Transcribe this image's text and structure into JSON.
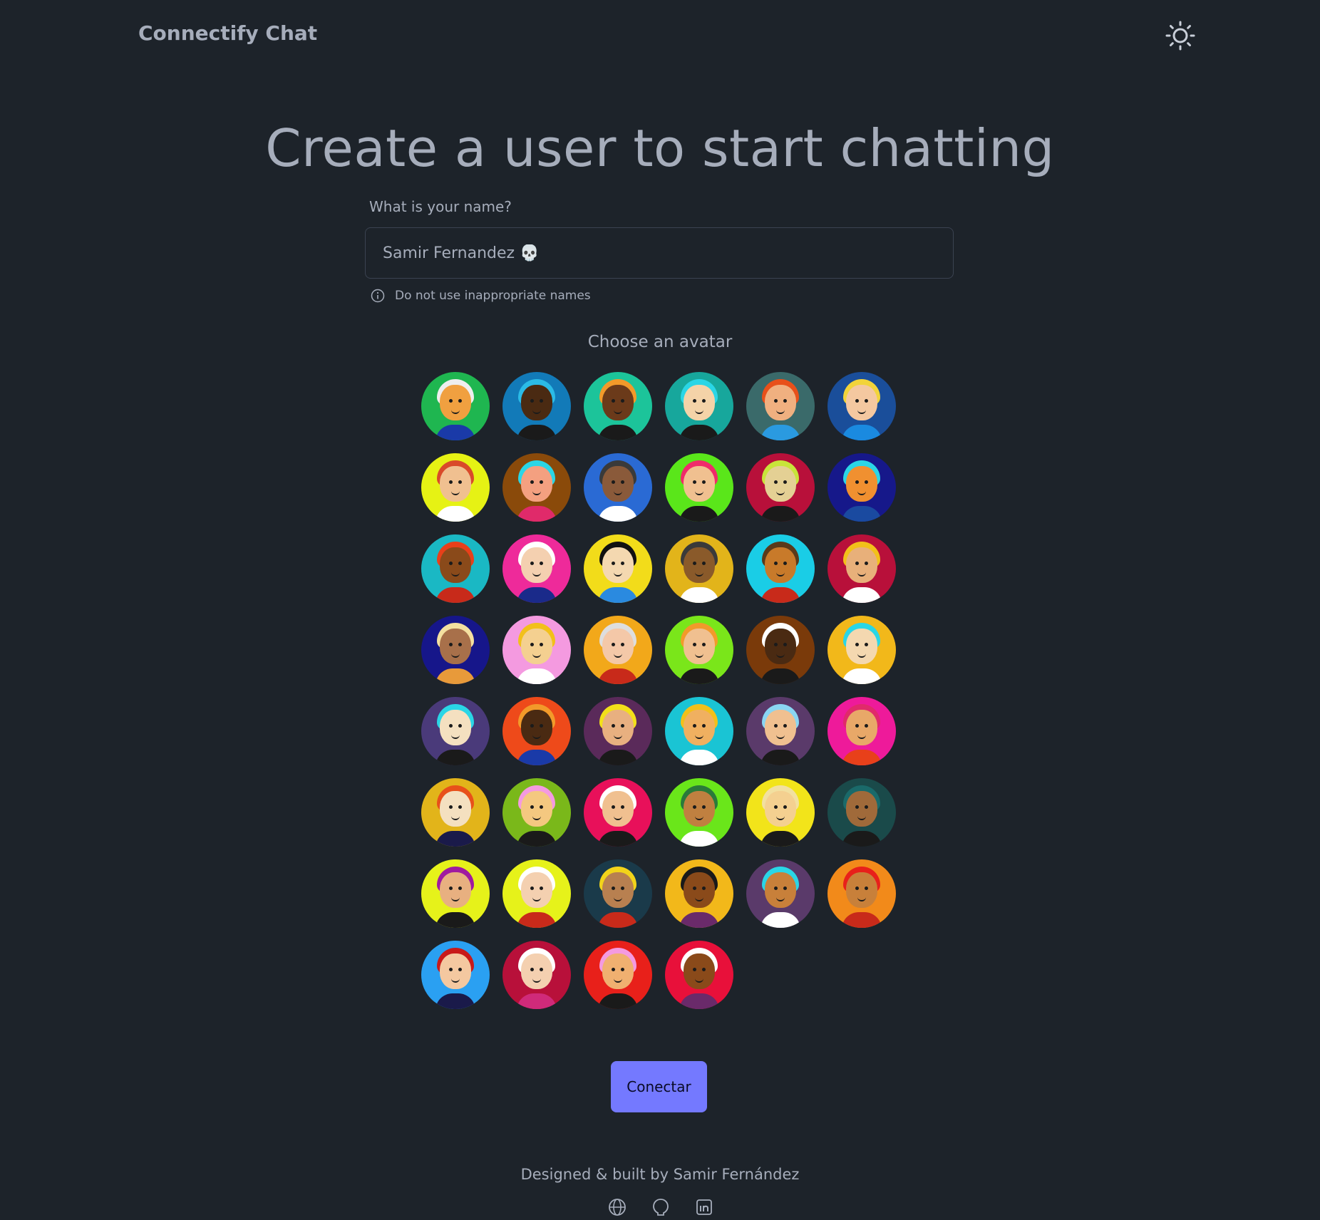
{
  "app": {
    "brand": "Connectify Chat"
  },
  "header": {
    "theme_icon": "sun-icon"
  },
  "page": {
    "title": "Create a user to start chatting"
  },
  "form": {
    "name_label": "What is your name?",
    "name_value": "Samir Fernandez 💀",
    "hint": "Do not use inappropriate names",
    "hint_icon": "info-icon"
  },
  "avatars": {
    "title": "Choose an avatar",
    "items": [
      {
        "bg": "#1fb650",
        "skin": "#f0a040",
        "hair": "#eeeeee",
        "body": "#1a3aa8"
      },
      {
        "bg": "#127ab8",
        "skin": "#4a2a12",
        "hair": "#2bbbe6",
        "body": "#1a1a1a"
      },
      {
        "bg": "#1cc49a",
        "skin": "#6b3a1a",
        "hair": "#f29a2a",
        "body": "#1a1a1a"
      },
      {
        "bg": "#17a79c",
        "skin": "#f4d3a8",
        "hair": "#2ad6e6",
        "body": "#1a1a1a"
      },
      {
        "bg": "#3a6a6a",
        "skin": "#f0b080",
        "hair": "#e8501a",
        "body": "#2a9ae0"
      },
      {
        "bg": "#1a4e9a",
        "skin": "#f4c8a0",
        "hair": "#f2d43a",
        "body": "#1a8ae0"
      },
      {
        "bg": "#e6f214",
        "skin": "#f0c090",
        "hair": "#d94a2a",
        "body": "#ffffff"
      },
      {
        "bg": "#8a4a0a",
        "skin": "#f4a080",
        "hair": "#2ad6e6",
        "body": "#e02a6a"
      },
      {
        "bg": "#2a6ad4",
        "skin": "#8a5a3a",
        "hair": "#3a3a3a",
        "body": "#ffffff"
      },
      {
        "bg": "#5ae61a",
        "skin": "#f0c090",
        "hair": "#f02a6a",
        "body": "#1a1a1a"
      },
      {
        "bg": "#b8103a",
        "skin": "#e4d094",
        "hair": "#c8e43a",
        "body": "#1a1a1a"
      },
      {
        "bg": "#16188a",
        "skin": "#f09030",
        "hair": "#2ad6e6",
        "body": "#1a4aa0"
      },
      {
        "bg": "#1ab8c4",
        "skin": "#8a4a1a",
        "hair": "#e8401a",
        "body": "#c82a1a"
      },
      {
        "bg": "#ee2a9a",
        "skin": "#f4d0b0",
        "hair": "#ffffff",
        "body": "#1a2a8a"
      },
      {
        "bg": "#f2dc1a",
        "skin": "#f4d8b0",
        "hair": "#111111",
        "body": "#2a8ae0"
      },
      {
        "bg": "#e2b41a",
        "skin": "#8a5a2a",
        "hair": "#3a3a3a",
        "body": "#ffffff"
      },
      {
        "bg": "#1acde6",
        "skin": "#c87a2a",
        "hair": "#5a3a1a",
        "body": "#c82a1a"
      },
      {
        "bg": "#b8103a",
        "skin": "#e8b07a",
        "hair": "#f2c01a",
        "body": "#ffffff"
      },
      {
        "bg": "#16168a",
        "skin": "#a8704a",
        "hair": "#f4e0a0",
        "body": "#e89a3a"
      },
      {
        "bg": "#f49ae0",
        "skin": "#f4d090",
        "hair": "#f2c01a",
        "body": "#ffffff"
      },
      {
        "bg": "#f2a81a",
        "skin": "#f4c8a8",
        "hair": "#dedede",
        "body": "#c82a1a"
      },
      {
        "bg": "#7ae61a",
        "skin": "#f0c090",
        "hair": "#f29a2a",
        "body": "#1a1a1a"
      },
      {
        "bg": "#7a3a0a",
        "skin": "#4a2a12",
        "hair": "#ffffff",
        "body": "#1a1a1a"
      },
      {
        "bg": "#f2b81a",
        "skin": "#f4d8b0",
        "hair": "#2ad6e6",
        "body": "#ffffff"
      },
      {
        "bg": "#4a3a7a",
        "skin": "#f4e0c0",
        "hair": "#2ad6e6",
        "body": "#1a1a1a"
      },
      {
        "bg": "#ee4a1a",
        "skin": "#4a2a12",
        "hair": "#f29a2a",
        "body": "#1a3aa8"
      },
      {
        "bg": "#5a2a5a",
        "skin": "#e8b080",
        "hair": "#f2e01a",
        "body": "#1a1a1a"
      },
      {
        "bg": "#1ac4d4",
        "skin": "#f0b060",
        "hair": "#f2c01a",
        "body": "#ffffff"
      },
      {
        "bg": "#5a3a6a",
        "skin": "#f0c090",
        "hair": "#8ad6f2",
        "body": "#1a1a1a"
      },
      {
        "bg": "#ee1a9a",
        "skin": "#e8a868",
        "hair": "#e02a6a",
        "body": "#e8401a"
      },
      {
        "bg": "#e2b41a",
        "skin": "#f4e0c0",
        "hair": "#e8501a",
        "body": "#1a1a4a"
      },
      {
        "bg": "#7ab81a",
        "skin": "#f4c880",
        "hair": "#f49ae0",
        "body": "#1a1a1a"
      },
      {
        "bg": "#e8105a",
        "skin": "#f0c090",
        "hair": "#ffffff",
        "body": "#1a1a1a"
      },
      {
        "bg": "#6ae61a",
        "skin": "#c08040",
        "hair": "#2a7a3a",
        "body": "#ffffff"
      },
      {
        "bg": "#f2e41a",
        "skin": "#f4d090",
        "hair": "#f2e0a0",
        "body": "#1a1a1a"
      },
      {
        "bg": "#1a4a4a",
        "skin": "#a06a3a",
        "hair": "#1a6a6a",
        "body": "#1a1a1a"
      },
      {
        "bg": "#e6f21a",
        "skin": "#e8b080",
        "hair": "#a01aa0",
        "body": "#1a1a1a"
      },
      {
        "bg": "#e6f21a",
        "skin": "#f4d0b0",
        "hair": "#ffffff",
        "body": "#c82a1a"
      },
      {
        "bg": "#1a3a4a",
        "skin": "#b88050",
        "hair": "#f2d41a",
        "body": "#c82a1a"
      },
      {
        "bg": "#f2b81a",
        "skin": "#8a4a1a",
        "hair": "#1a1a1a",
        "body": "#6a2a6a"
      },
      {
        "bg": "#5a3a6a",
        "skin": "#c8803a",
        "hair": "#2ad6e6",
        "body": "#ffffff"
      },
      {
        "bg": "#f28a1a",
        "skin": "#c8803a",
        "hair": "#e8201a",
        "body": "#c82a1a"
      },
      {
        "bg": "#2aa0f2",
        "skin": "#f4c8a0",
        "hair": "#c81a1a",
        "body": "#1a1a4a"
      },
      {
        "bg": "#b8103a",
        "skin": "#f4d0b0",
        "hair": "#ffffff",
        "body": "#d02a7a"
      },
      {
        "bg": "#e8201a",
        "skin": "#f0b070",
        "hair": "#f49ae0",
        "body": "#1a1a1a"
      },
      {
        "bg": "#e8103a",
        "skin": "#8a4a1a",
        "hair": "#ffffff",
        "body": "#6a2a6a"
      }
    ]
  },
  "actions": {
    "connect_label": "Conectar"
  },
  "footer": {
    "credit": "Designed & built by Samir Fernández",
    "icons": [
      "globe-icon",
      "github-icon",
      "linkedin-icon"
    ]
  }
}
